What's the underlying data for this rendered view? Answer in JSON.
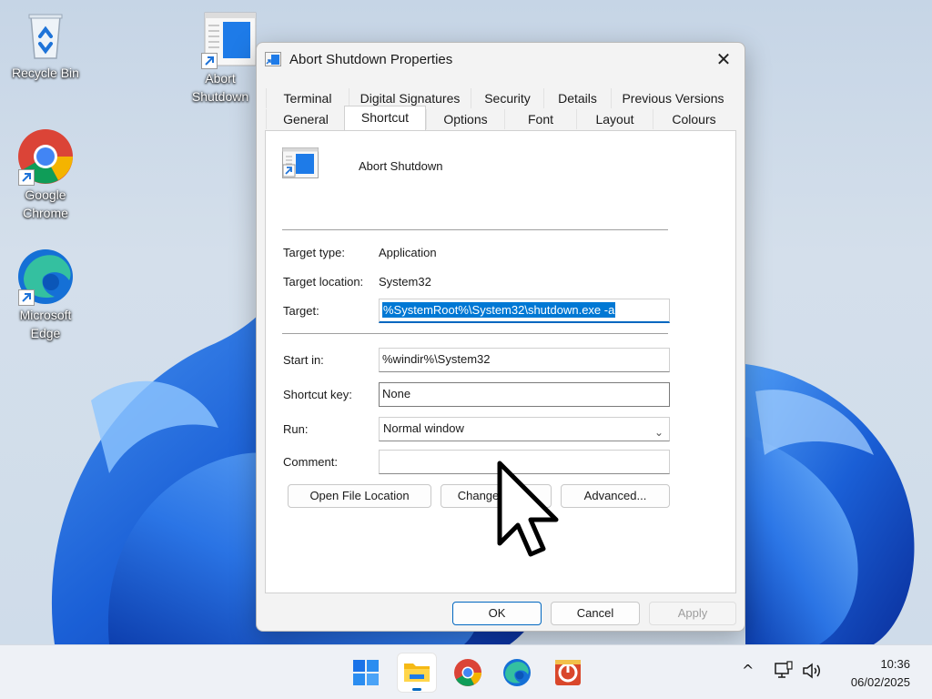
{
  "desktop": {
    "icons": [
      {
        "label": "Recycle Bin"
      },
      {
        "label": "Abort Shutdown"
      },
      {
        "label": "Google Chrome"
      },
      {
        "label": "Microsoft Edge"
      }
    ]
  },
  "dialog": {
    "title": "Abort Shutdown Properties",
    "close_glyph": "✕",
    "tabs_row1": [
      "Terminal",
      "Digital Signatures",
      "Security",
      "Details",
      "Previous Versions"
    ],
    "tabs_row2": [
      "General",
      "Shortcut",
      "Options",
      "Font",
      "Layout",
      "Colours"
    ],
    "active_tab": "Shortcut",
    "shortcut": {
      "name": "Abort Shutdown",
      "target_type_label": "Target type:",
      "target_type_value": "Application",
      "target_location_label": "Target location:",
      "target_location_value": "System32",
      "target_label": "Target:",
      "target_value": "%SystemRoot%\\System32\\shutdown.exe -a",
      "start_in_label": "Start in:",
      "start_in_value": "%windir%\\System32",
      "shortcut_key_label": "Shortcut key:",
      "shortcut_key_value": "None",
      "run_label": "Run:",
      "run_value": "Normal window",
      "comment_label": "Comment:",
      "comment_value": "",
      "open_file_location": "Open File Location",
      "change_icon": "Change Icon...",
      "advanced": "Advanced..."
    },
    "footer": {
      "ok": "OK",
      "cancel": "Cancel",
      "apply": "Apply"
    }
  },
  "taskbar": {
    "apps": [
      "start-icon",
      "file-explorer-icon",
      "chrome-icon",
      "edge-icon",
      "abort-shutdown-icon"
    ],
    "tray": {
      "chevron_glyph": "^",
      "time": "10:36",
      "date": "06/02/2025"
    }
  },
  "colors": {
    "accent": "#0067c0",
    "selection": "#0078d4",
    "wallpaper_bloom": "#1a5fd6"
  }
}
